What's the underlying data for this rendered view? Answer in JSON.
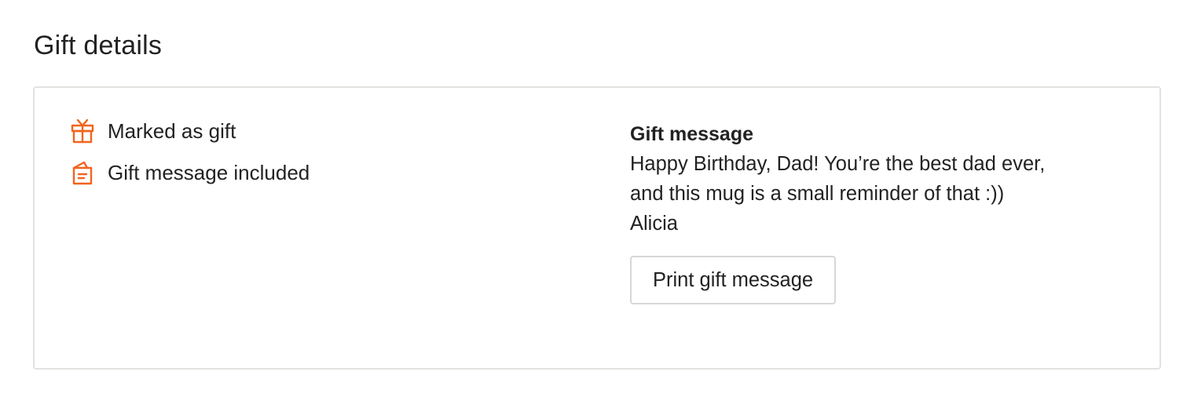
{
  "section": {
    "title": "Gift details"
  },
  "flags": [
    {
      "icon": "gift-icon",
      "label": "Marked as gift"
    },
    {
      "icon": "gift-message-card-icon",
      "label": "Gift message included"
    }
  ],
  "gift_message": {
    "heading": "Gift message",
    "lines": [
      "Happy Birthday, Dad! You’re the best dad ever,",
      "and this mug is a small reminder of that :))",
      "Alicia"
    ],
    "print_button_label": "Print gift message"
  },
  "colors": {
    "icon_accent": "#f1641e",
    "card_border": "#e1e3df",
    "button_border": "#d6d8d4",
    "text": "#222222"
  }
}
